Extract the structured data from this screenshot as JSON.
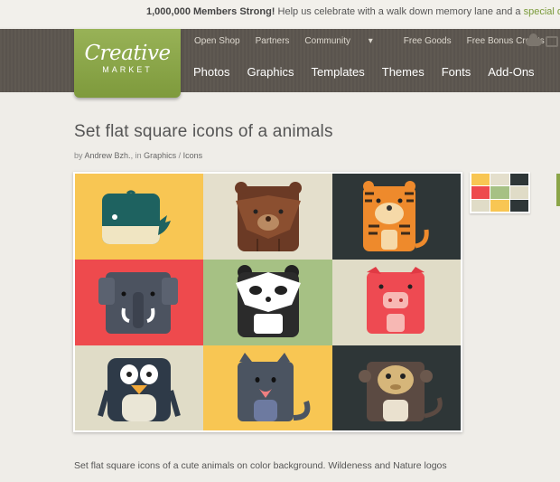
{
  "announcement": {
    "bold": "1,000,000 Members Strong!",
    "text": " Help us celebrate with a walk down memory lane and a ",
    "link": "special disco"
  },
  "logo": {
    "word": "Creative",
    "sub": "MARKET"
  },
  "topnav": {
    "items": [
      {
        "label": "Open Shop"
      },
      {
        "label": "Partners"
      },
      {
        "label": "Community"
      },
      {
        "label": "Free Goods"
      },
      {
        "label": "Free Bonus Credits"
      }
    ],
    "community_caret": "▾"
  },
  "mainnav": {
    "items": [
      {
        "label": "Photos"
      },
      {
        "label": "Graphics"
      },
      {
        "label": "Templates"
      },
      {
        "label": "Themes"
      },
      {
        "label": "Fonts"
      },
      {
        "label": "Add-Ons"
      }
    ]
  },
  "product": {
    "title": "Set flat square icons of a animals",
    "by": "by",
    "author": "Andrew Bzh.",
    "in": ", in",
    "category": "Graphics",
    "sep": " / ",
    "subcategory": "Icons",
    "description": "Set flat square icons of a cute animals on color background. Wildeness and Nature logos"
  },
  "gallery": {
    "cells": [
      {
        "animal": "whale-icon",
        "bg": "#f8c653"
      },
      {
        "animal": "bear-icon",
        "bg": "#e4dfcc"
      },
      {
        "animal": "tiger-icon",
        "bg": "#2e3637"
      },
      {
        "animal": "elephant-icon",
        "bg": "#ee4a4d"
      },
      {
        "animal": "panda-icon",
        "bg": "#a6c184"
      },
      {
        "animal": "pig-icon",
        "bg": "#e0dcc7"
      },
      {
        "animal": "penguin-icon",
        "bg": "#e0dcc7"
      },
      {
        "animal": "cat-icon",
        "bg": "#f8c653"
      },
      {
        "animal": "monkey-icon",
        "bg": "#2e3637"
      }
    ]
  }
}
